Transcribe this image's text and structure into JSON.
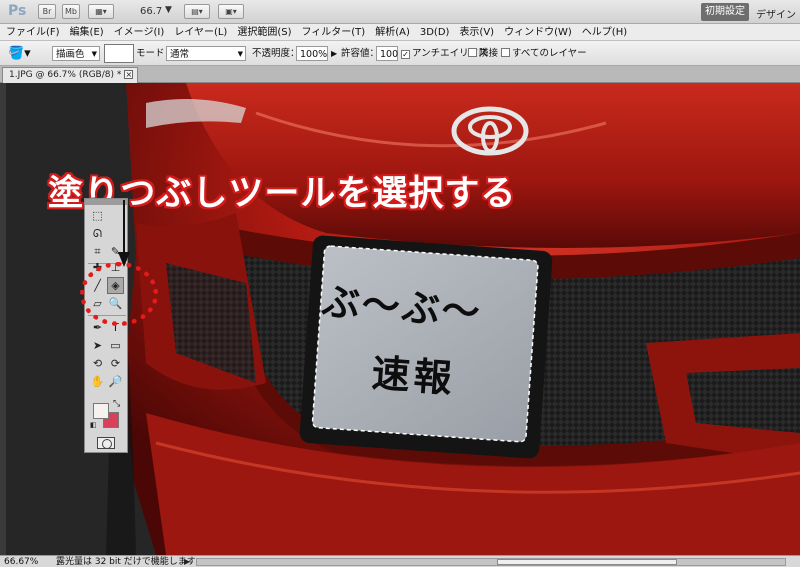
{
  "app": {
    "logo": "Ps"
  },
  "appbar": {
    "zoom": "66.7",
    "workspaces": [
      "初期設定",
      "デザイン"
    ]
  },
  "menu": [
    "ファイル(F)",
    "編集(E)",
    "イメージ(I)",
    "レイヤー(L)",
    "選択範囲(S)",
    "フィルター(T)",
    "解析(A)",
    "3D(D)",
    "表示(V)",
    "ウィンドウ(W)",
    "ヘルプ(H)"
  ],
  "options": {
    "fill_source": "描画色",
    "mode_label": "モード：",
    "mode_value": "通常",
    "opacity_label": "不透明度：",
    "opacity_value": "100%",
    "tolerance_label": "許容値：",
    "tolerance_value": "100",
    "antialias_label": "アンチエイリアス",
    "contiguous_label": "隣接",
    "all_layers_label": "すべてのレイヤー"
  },
  "document": {
    "tab_title": "1.JPG @ 66.7% (RGB/8) *"
  },
  "annotation": {
    "headline": "塗りつぶしツールを選択する"
  },
  "plate": {
    "line1": "ぶ～ぶ～",
    "line2": "速報"
  },
  "status": {
    "zoom": "66.67%",
    "message": "露光量は 32 bit だけで機能します"
  },
  "colors": {
    "foreground": "#f4f1ee",
    "background": "#d9405a",
    "highlight": "#e51b1b",
    "car_body": "#b01a12"
  }
}
